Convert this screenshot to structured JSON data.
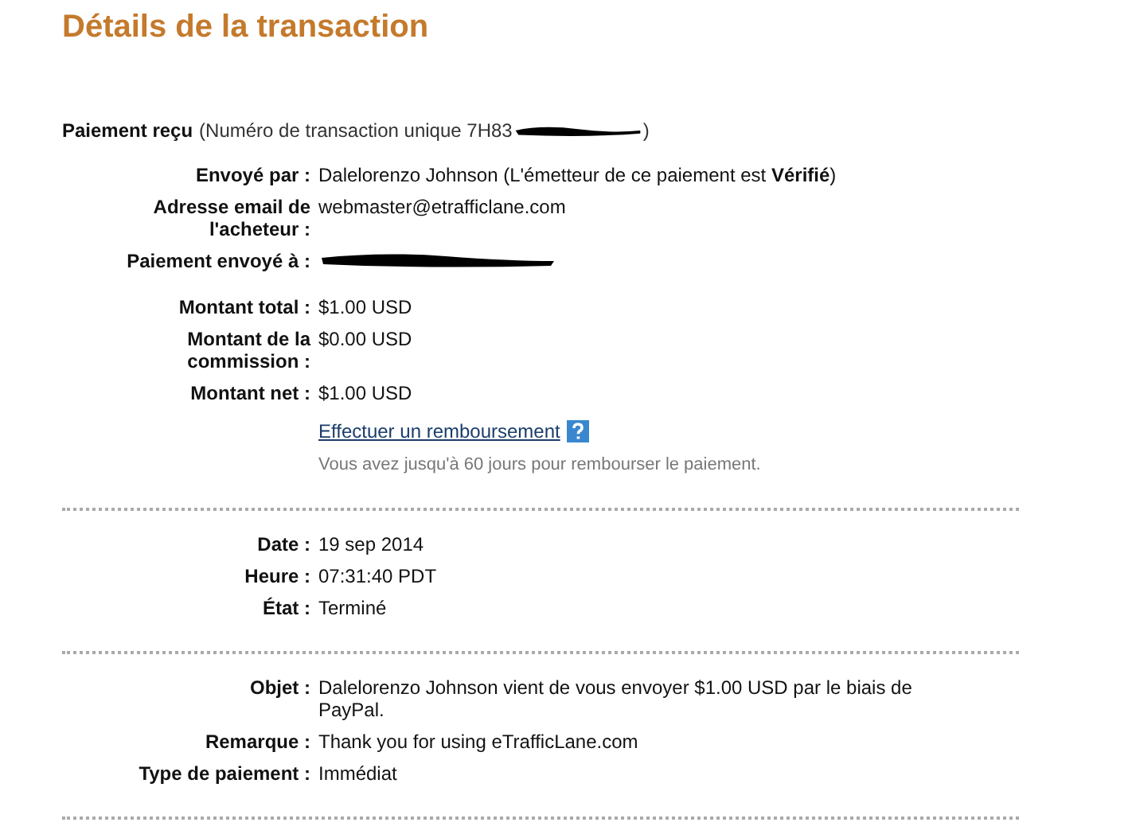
{
  "title": "Détails de la transaction",
  "header": {
    "label": "Paiement reçu",
    "detail": "(Numéro de transaction unique 7H83",
    "redacted": true,
    "detail_end": ")"
  },
  "sections": [
    {
      "rows": [
        {
          "kind": "text",
          "label": "Envoyé par :",
          "value": "Dalelorenzo Johnson (L'émetteur de ce paiement est **Vérifié**)"
        },
        {
          "kind": "text",
          "label": "Adresse email de l'acheteur :",
          "value": "webmaster@etrafficlane.com"
        },
        {
          "kind": "redacted",
          "label": "Paiement envoyé à :"
        },
        {
          "kind": "text",
          "label": "Montant total :",
          "value": "$1.00 USD"
        },
        {
          "kind": "text",
          "label": "Montant de la commission :",
          "value": "$0.00 USD"
        },
        {
          "kind": "text",
          "label": "Montant net :",
          "value": "$1.00 USD"
        },
        {
          "kind": "link",
          "value": "Effectuer un remboursement"
        },
        {
          "kind": "note",
          "value": "Vous avez jusqu'à 60 jours pour rembourser le paiement."
        }
      ]
    },
    {
      "rows": [
        {
          "kind": "text",
          "label": "Date :",
          "value": "19 sep 2014"
        },
        {
          "kind": "text",
          "label": "Heure :",
          "value": "07:31:40 PDT"
        },
        {
          "kind": "text",
          "label": "État :",
          "value": "Terminé"
        }
      ]
    },
    {
      "rows": [
        {
          "kind": "text",
          "label": "Objet :",
          "value": "Dalelorenzo Johnson vient de vous envoyer $1.00 USD par le biais de PayPal."
        },
        {
          "kind": "text",
          "label": "Remarque :",
          "value": "Thank you for using eTrafficLane.com"
        },
        {
          "kind": "text",
          "label": "Type de paiement :",
          "value": "Immédiat"
        }
      ]
    }
  ]
}
